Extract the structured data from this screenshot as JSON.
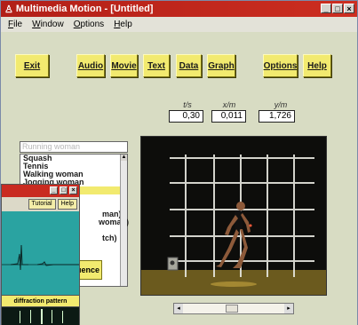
{
  "window": {
    "title": "Multimedia Motion - [Untitled]",
    "controls": [
      "_",
      "□",
      "×"
    ]
  },
  "menu": [
    "File",
    "Window",
    "Options",
    "Help"
  ],
  "toolbar": {
    "exit": "Exit",
    "audio": "Audio",
    "movie": "Movie",
    "text": "Text",
    "data": "Data",
    "graph": "Graph",
    "options": "Options",
    "help": "Help"
  },
  "readouts": {
    "t_label": "t/s",
    "t_value": "0,30",
    "x_label": "x/m",
    "x_value": "0,011",
    "y_label": "y/m",
    "y_value": "1,726"
  },
  "list": {
    "header": "Running woman",
    "items": [
      "Squash",
      "Tennis",
      "Walking woman",
      "Jogging woman",
      "",
      "",
      "",
      "man)",
      "woman)",
      "",
      "tch)"
    ],
    "selected_index": 4
  },
  "sequence_button": "uence",
  "subwindow": {
    "tutorial": "Tutorial",
    "help": "Help",
    "caption": "diffraction pattern"
  },
  "scroll": {
    "left": "◂",
    "right": "▸"
  },
  "colors": {
    "button": "#f2ea6f",
    "title": "#c92b21",
    "background": "#d8dcc3"
  }
}
